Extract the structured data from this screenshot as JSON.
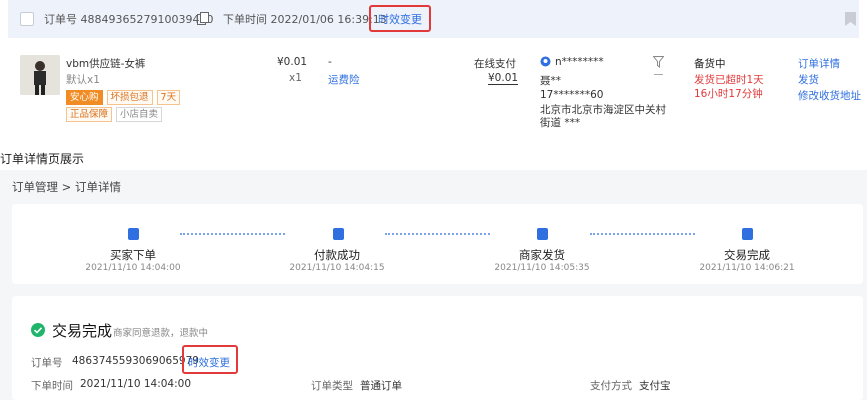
{
  "order_list": {
    "header": {
      "order_no_label": "订单号",
      "order_no": "4884936527910039440",
      "time_label": "下单时间",
      "time": "2022/01/06 16:39:13",
      "change_label": "时效变更"
    },
    "product": {
      "name": "vbm供应链-女裤",
      "spec": "默认x1",
      "tags": [
        "安心购",
        "坏损包退",
        "7天"
      ],
      "tags2": [
        "正品保障",
        "小店自卖"
      ],
      "price": "¥0.01",
      "qty": "x1",
      "discount": "-",
      "shipping_insurance": "运费险",
      "pay_method": "在线支付",
      "pay_amount": "¥0.01"
    },
    "buyer": {
      "nickname": "n********",
      "name": "聂**",
      "phone": "17*******60",
      "address_line1": "北京市北京市海淀区中关村",
      "address_line2": "街道 ***"
    },
    "status": {
      "title": "备货中",
      "warn1": "发货已超时1天",
      "warn2": "16小时17分钟"
    },
    "actions": [
      "订单详情",
      "发货",
      "修改收货地址"
    ]
  },
  "detail": {
    "section_label": "订单详情页展示",
    "breadcrumb": "订单管理 > 订单详情",
    "steps": [
      {
        "title": "买家下单",
        "time": "2021/11/10 14:04:00"
      },
      {
        "title": "付款成功",
        "time": "2021/11/10 14:04:15"
      },
      {
        "title": "商家发货",
        "time": "2021/11/10 14:05:35"
      },
      {
        "title": "交易完成",
        "time": "2021/11/10 14:06:21"
      }
    ],
    "status_title": "交易完成",
    "status_note": "商家同意退款，退款中",
    "order_no_label": "订单号",
    "order_no": "4863745593069065979",
    "change_label": "时效变更",
    "order_time_label": "下单时间",
    "order_time": "2021/11/10 14:04:00",
    "order_type_label": "订单类型",
    "order_type": "普通订单",
    "pay_label": "支付方式",
    "pay_value": "支付宝"
  },
  "colors": {
    "accent": "#2f6fe0",
    "highlight_box": "#e23a3a",
    "success": "#1fb56b",
    "warning": "#e23a3a"
  }
}
